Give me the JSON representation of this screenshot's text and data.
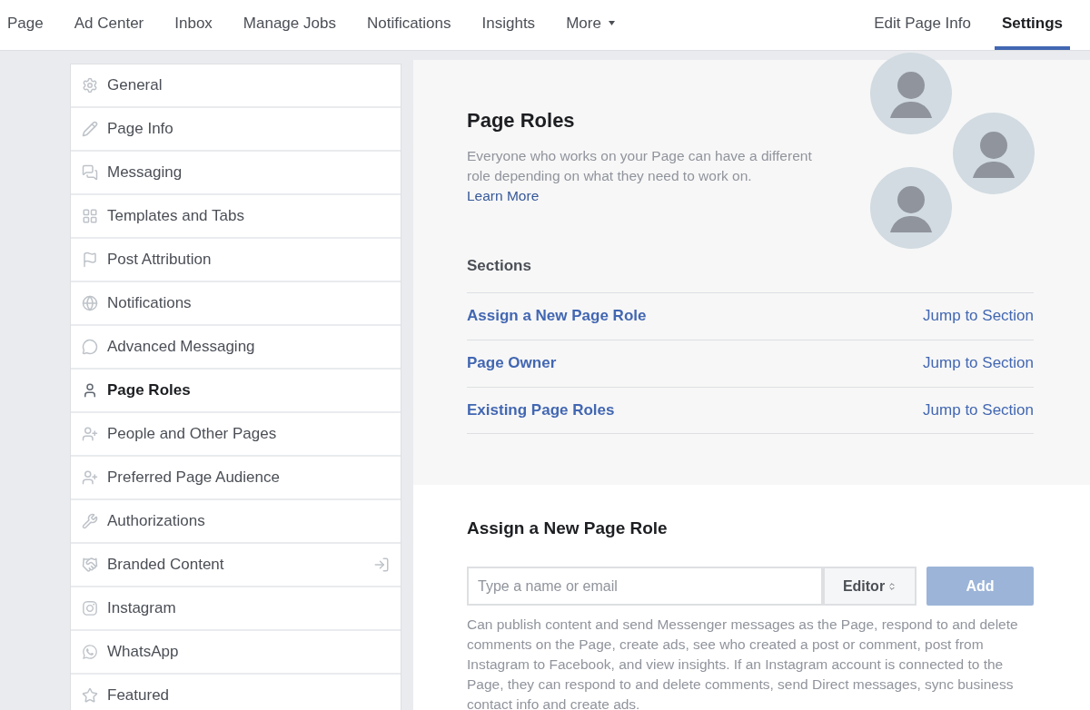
{
  "nav": {
    "left": [
      {
        "label": "Page",
        "selected": false
      },
      {
        "label": "Ad Center",
        "selected": false
      },
      {
        "label": "Inbox",
        "selected": false
      },
      {
        "label": "Manage Jobs",
        "selected": false
      },
      {
        "label": "Notifications",
        "selected": false
      },
      {
        "label": "Insights",
        "selected": false
      },
      {
        "label": "More",
        "selected": false,
        "dropdown": true
      }
    ],
    "right": [
      {
        "label": "Edit Page Info",
        "selected": false
      },
      {
        "label": "Settings",
        "selected": true
      }
    ]
  },
  "sidebar": {
    "items": [
      {
        "label": "General",
        "selected": false
      },
      {
        "label": "Page Info",
        "selected": false
      },
      {
        "label": "Messaging",
        "selected": false
      },
      {
        "label": "Templates and Tabs",
        "selected": false
      },
      {
        "label": "Post Attribution",
        "selected": false
      },
      {
        "label": "Notifications",
        "selected": false
      },
      {
        "label": "Advanced Messaging",
        "selected": false
      },
      {
        "label": "Page Roles",
        "selected": true
      },
      {
        "label": "People and Other Pages",
        "selected": false
      },
      {
        "label": "Preferred Page Audience",
        "selected": false
      },
      {
        "label": "Authorizations",
        "selected": false
      },
      {
        "label": "Branded Content",
        "selected": false,
        "external": true
      },
      {
        "label": "Instagram",
        "selected": false
      },
      {
        "label": "WhatsApp",
        "selected": false
      },
      {
        "label": "Featured",
        "selected": false
      }
    ]
  },
  "intro": {
    "title": "Page Roles",
    "description": "Everyone who works on your Page can have a different role depending on what they need to work on.",
    "link": "Learn More"
  },
  "sections": {
    "heading": "Sections",
    "rows": [
      {
        "name": "Assign a New Page Role",
        "action": "Jump to Section"
      },
      {
        "name": "Page Owner",
        "action": "Jump to Section"
      },
      {
        "name": "Existing Page Roles",
        "action": "Jump to Section"
      }
    ]
  },
  "assign": {
    "title": "Assign a New Page Role",
    "placeholder": "Type a name or email",
    "role": "Editor",
    "button": "Add",
    "button_disabled": true,
    "help": "Can publish content and send Messenger messages as the Page, respond to and delete comments on the Page, create ads, see who created a post or comment, post from Instagram to Facebook, and view insights. If an Instagram account is connected to the Page, they can respond to and delete comments, send Direct messages, sync business contact info and create ads."
  }
}
